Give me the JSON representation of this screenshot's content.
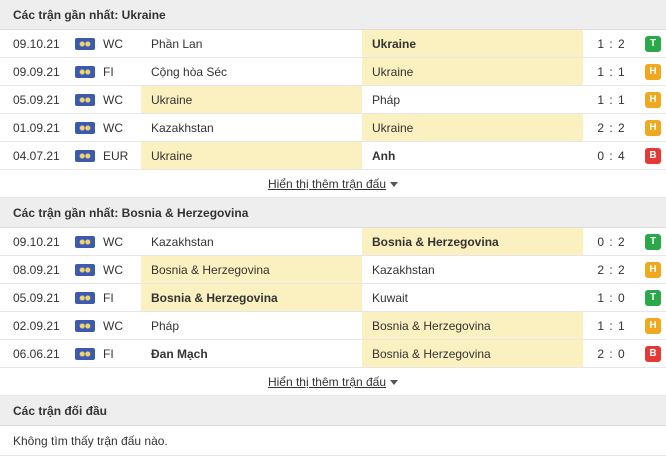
{
  "colors": {
    "T": "#2aa84a",
    "H": "#f0a81e",
    "B": "#e53935",
    "highlight": "#fbf0bf"
  },
  "sections": [
    {
      "title": "Các trận gần nhất: Ukraine",
      "more_label": "Hiển thị thêm trận đấu",
      "matches": [
        {
          "date": "09.10.21",
          "comp": "WC",
          "home": "Phần Lan",
          "away": "Ukraine",
          "score": "1 : 2",
          "result": "T",
          "hl": "away",
          "bold": "away"
        },
        {
          "date": "09.09.21",
          "comp": "FI",
          "home": "Cộng hòa Séc",
          "away": "Ukraine",
          "score": "1 : 1",
          "result": "H",
          "hl": "away",
          "bold": ""
        },
        {
          "date": "05.09.21",
          "comp": "WC",
          "home": "Ukraine",
          "away": "Pháp",
          "score": "1 : 1",
          "result": "H",
          "hl": "home",
          "bold": ""
        },
        {
          "date": "01.09.21",
          "comp": "WC",
          "home": "Kazakhstan",
          "away": "Ukraine",
          "score": "2 : 2",
          "result": "H",
          "hl": "away",
          "bold": ""
        },
        {
          "date": "04.07.21",
          "comp": "EUR",
          "home": "Ukraine",
          "away": "Anh",
          "score": "0 : 4",
          "result": "B",
          "hl": "home",
          "bold": "away"
        }
      ]
    },
    {
      "title": "Các trận gần nhất: Bosnia & Herzegovina",
      "more_label": "Hiển thị thêm trận đấu",
      "matches": [
        {
          "date": "09.10.21",
          "comp": "WC",
          "home": "Kazakhstan",
          "away": "Bosnia & Herzegovina",
          "score": "0 : 2",
          "result": "T",
          "hl": "away",
          "bold": "away"
        },
        {
          "date": "08.09.21",
          "comp": "WC",
          "home": "Bosnia & Herzegovina",
          "away": "Kazakhstan",
          "score": "2 : 2",
          "result": "H",
          "hl": "home",
          "bold": ""
        },
        {
          "date": "05.09.21",
          "comp": "FI",
          "home": "Bosnia & Herzegovina",
          "away": "Kuwait",
          "score": "1 : 0",
          "result": "T",
          "hl": "home",
          "bold": "home"
        },
        {
          "date": "02.09.21",
          "comp": "WC",
          "home": "Pháp",
          "away": "Bosnia & Herzegovina",
          "score": "1 : 1",
          "result": "H",
          "hl": "away",
          "bold": ""
        },
        {
          "date": "06.06.21",
          "comp": "FI",
          "home": "Đan Mạch",
          "away": "Bosnia & Herzegovina",
          "score": "2 : 0",
          "result": "B",
          "hl": "away",
          "bold": "home"
        }
      ]
    }
  ],
  "h2h": {
    "title": "Các trận đối đầu",
    "empty_text": "Không tìm thấy trận đấu nào."
  }
}
